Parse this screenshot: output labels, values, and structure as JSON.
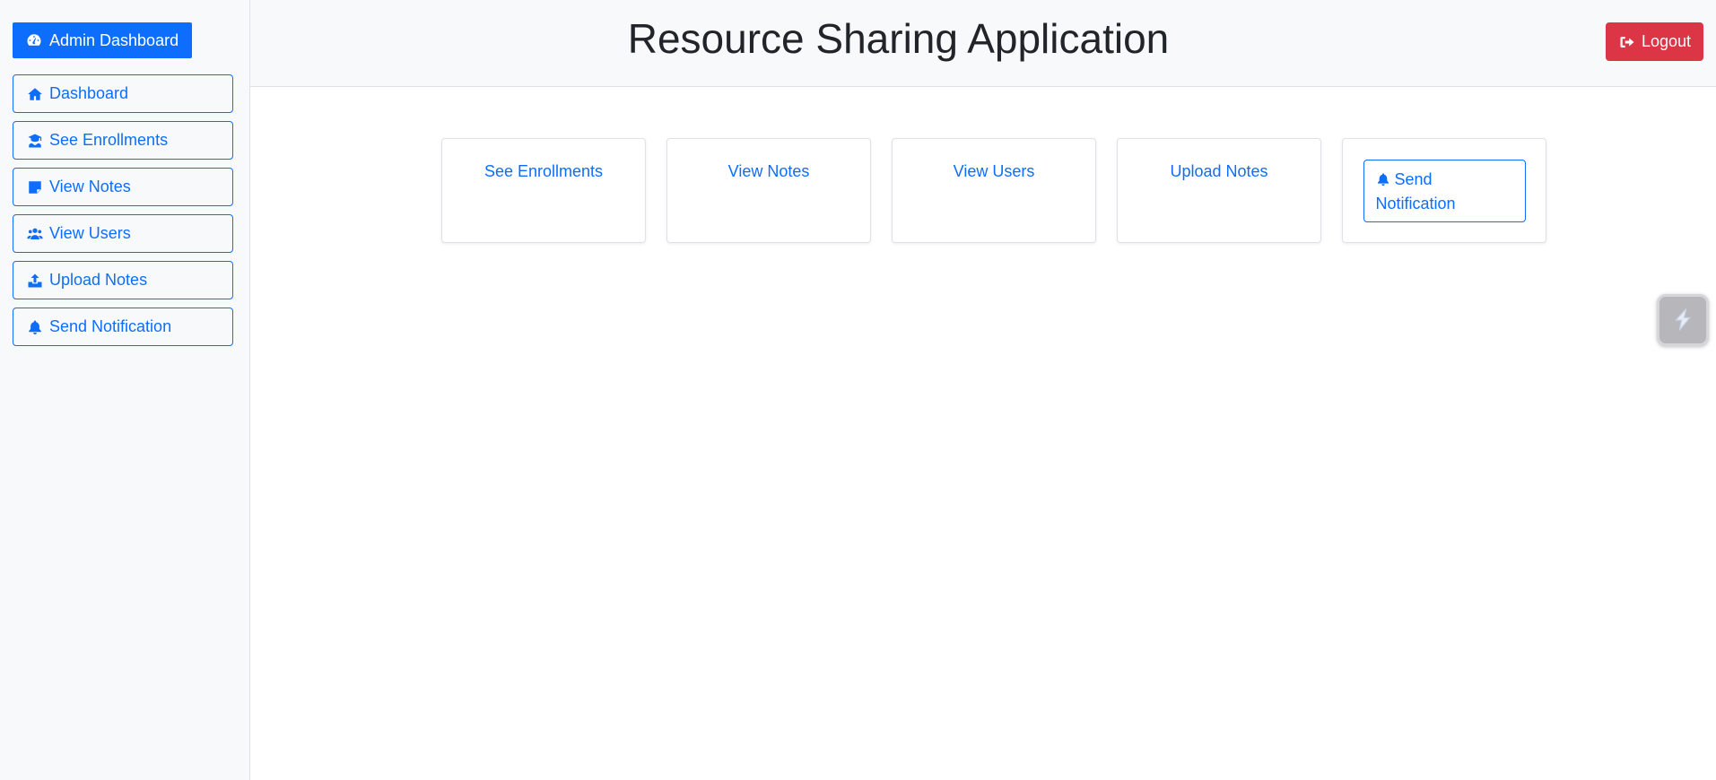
{
  "app": {
    "title": "Resource Sharing Application",
    "brand_label": "Admin Dashboard"
  },
  "header": {
    "logout_label": "Logout"
  },
  "sidebar": {
    "items": [
      {
        "label": "Dashboard",
        "icon": "home-icon"
      },
      {
        "label": "See Enrollments",
        "icon": "graduate-icon"
      },
      {
        "label": "View Notes",
        "icon": "note-icon"
      },
      {
        "label": "View Users",
        "icon": "users-icon"
      },
      {
        "label": "Upload Notes",
        "icon": "upload-icon"
      },
      {
        "label": "Send Notification",
        "icon": "bell-icon"
      }
    ]
  },
  "cards": [
    {
      "label": "See Enrollments"
    },
    {
      "label": "View Notes"
    },
    {
      "label": "View Users"
    },
    {
      "label": "Upload Notes"
    },
    {
      "label": "Send Notification",
      "icon": "bell-icon"
    }
  ],
  "colors": {
    "primary": "#0d6efd",
    "danger": "#dc3545",
    "sidebar_bg": "#f8f9fa"
  }
}
